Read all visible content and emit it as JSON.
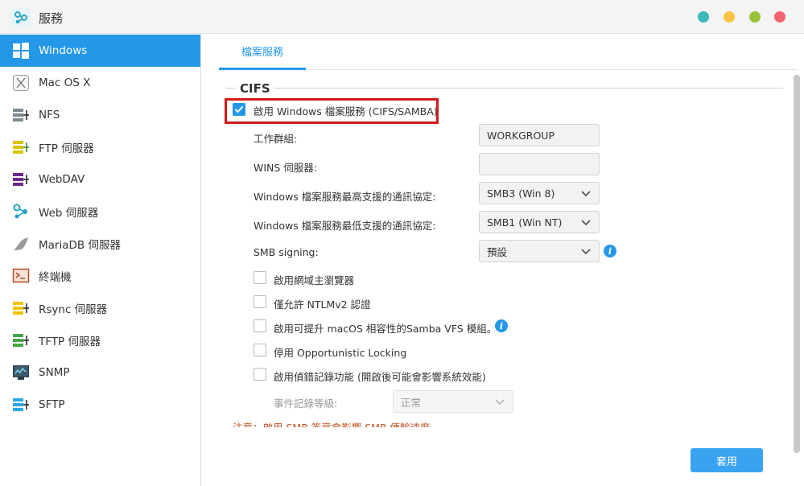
{
  "window": {
    "title": "服務",
    "controls": {
      "teal": "#3cb8b8",
      "yellow": "#f5c447",
      "green": "#9ac23c",
      "red": "#f2646e"
    }
  },
  "sidebar": {
    "items": [
      {
        "label": "Windows",
        "icon": "windows-icon",
        "active": true
      },
      {
        "label": "Mac OS X",
        "icon": "macos-icon"
      },
      {
        "label": "NFS",
        "icon": "nfs-icon"
      },
      {
        "label": "FTP 伺服器",
        "icon": "ftp-icon"
      },
      {
        "label": "WebDAV",
        "icon": "webdav-icon"
      },
      {
        "label": "Web 伺服器",
        "icon": "web-server-icon"
      },
      {
        "label": "MariaDB 伺服器",
        "icon": "mariadb-icon"
      },
      {
        "label": "終端機",
        "icon": "terminal-icon"
      },
      {
        "label": "Rsync 伺服器",
        "icon": "rsync-icon"
      },
      {
        "label": "TFTP 伺服器",
        "icon": "tftp-icon"
      },
      {
        "label": "SNMP",
        "icon": "snmp-icon"
      },
      {
        "label": "SFTP",
        "icon": "sftp-icon"
      }
    ]
  },
  "main": {
    "tabs": [
      {
        "label": "檔案服務"
      }
    ],
    "section": "CIFS",
    "enable_cifs": {
      "label": "啟用 Windows 檔案服務 (CIFS/SAMBA)",
      "checked": true
    },
    "workgroup": {
      "label": "工作群組:",
      "value": "WORKGROUP"
    },
    "wins": {
      "label": "WINS 伺服器:",
      "value": ""
    },
    "max_protocol": {
      "label": "Windows 檔案服務最高支援的通訊協定:",
      "value": "SMB3 (Win 8)"
    },
    "min_protocol": {
      "label": "Windows 檔案服務最低支援的通訊協定:",
      "value": "SMB1 (Win NT)"
    },
    "smb_signing": {
      "label": "SMB signing:",
      "value": "預設"
    },
    "options": [
      {
        "label": "啟用網域主瀏覽器",
        "checked": false
      },
      {
        "label": "僅允許 NTLMv2 認證",
        "checked": false
      },
      {
        "label": "啟用可提升 macOS 相容性的Samba VFS 模組。",
        "checked": false
      },
      {
        "label": "停用 Opportunistic Locking",
        "checked": false
      },
      {
        "label": "啟用偵錯記錄功能 (開啟後可能會影響系統效能)",
        "checked": false
      }
    ],
    "log_level": {
      "label": "事件記錄等級:",
      "value": "正常"
    },
    "note": "注意：啟用 SMB 簽章會影響 SMB 傳輸速度。",
    "apply_label": "套用"
  },
  "colors": {
    "accent": "#2497e9",
    "highlight": "#d11a1a",
    "note": "#c0552a"
  }
}
